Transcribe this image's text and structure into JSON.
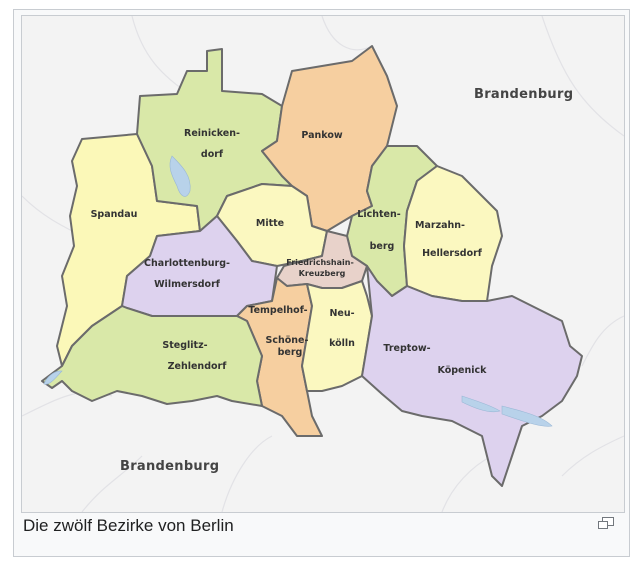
{
  "caption": "Die zwölf Bezirke von Berlin",
  "surrounding": {
    "north_east": "Brandenburg",
    "south_west": "Brandenburg"
  },
  "districts": [
    {
      "key": "reinickendorf",
      "lines": [
        "Reinicken-",
        "dorf"
      ],
      "color": "#d9e8a8"
    },
    {
      "key": "pankow",
      "lines": [
        "Pankow"
      ],
      "color": "#f6cfa0"
    },
    {
      "key": "spandau",
      "lines": [
        "Spandau"
      ],
      "color": "#fbf8b8"
    },
    {
      "key": "mitte",
      "lines": [
        "Mitte"
      ],
      "color": "#fbf8c0"
    },
    {
      "key": "lichtenberg",
      "lines": [
        "Lichten-",
        "berg"
      ],
      "color": "#d9e8a8"
    },
    {
      "key": "marzahn",
      "lines": [
        "Marzahn-",
        "Hellersdorf"
      ],
      "color": "#fbf8c0"
    },
    {
      "key": "friedrichshain",
      "lines": [
        "Friedrichshain-",
        "Kreuzberg"
      ],
      "color": "#e8d2ca"
    },
    {
      "key": "charlottenburg",
      "lines": [
        "Charlottenburg-",
        "Wilmersdorf"
      ],
      "color": "#ddd2ee"
    },
    {
      "key": "tempelhof",
      "lines": [
        "Tempelhof-",
        "Schöne-",
        "berg"
      ],
      "color": "#f6cfa0"
    },
    {
      "key": "neukoelln",
      "lines": [
        "Neu-",
        "kölln"
      ],
      "color": "#fbf8c0"
    },
    {
      "key": "treptow",
      "lines": [
        "Treptow-",
        "Köpenick"
      ],
      "color": "#ddd2ee"
    },
    {
      "key": "steglitz",
      "lines": [
        "Steglitz-",
        "Zehlendorf"
      ],
      "color": "#d9e8a8"
    }
  ],
  "colors": {
    "border": "#6b6b6b",
    "water": "#b8d2ea",
    "background": "#f3f3f3"
  },
  "icons": {
    "enlarge": "enlarge-icon"
  }
}
